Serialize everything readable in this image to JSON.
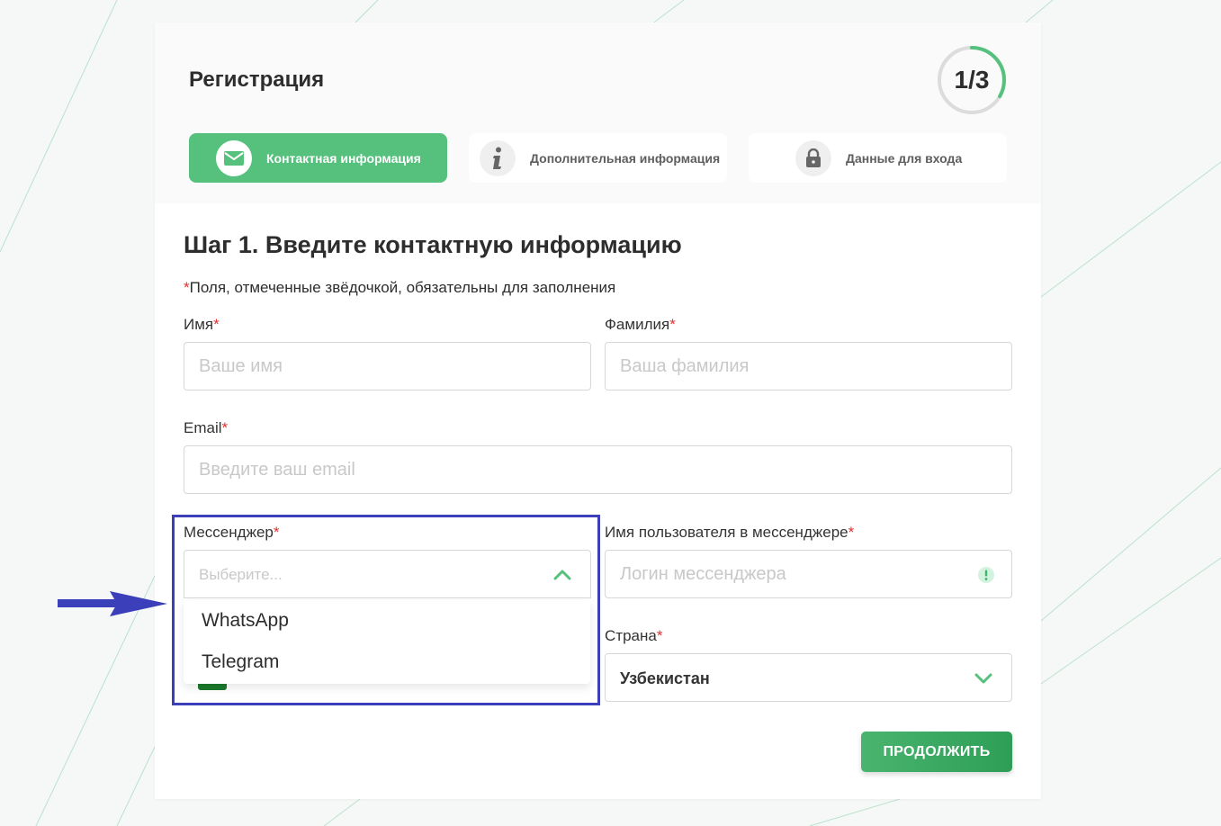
{
  "header": {
    "title": "Регистрация",
    "progress_text": "1/3",
    "progress_fraction": 0.333
  },
  "steps": [
    {
      "label": "Контактная информация",
      "icon": "mail-icon",
      "active": true
    },
    {
      "label": "Дополнительная информация",
      "icon": "info-icon",
      "active": false
    },
    {
      "label": "Данные для входа",
      "icon": "lock-icon",
      "active": false
    }
  ],
  "form": {
    "heading": "Шаг 1. Введите контактную информацию",
    "required_note_star": "*",
    "required_note": "Поля, отмеченные звёдочкой, обязательны для заполнения",
    "first_name": {
      "label": "Имя",
      "placeholder": "Ваше имя",
      "value": ""
    },
    "last_name": {
      "label": "Фамилия",
      "placeholder": "Ваша фамилия",
      "value": ""
    },
    "email": {
      "label": "Email",
      "placeholder": "Введите ваш email",
      "value": ""
    },
    "messenger": {
      "label": "Мессенджер",
      "placeholder": "Выберите...",
      "options": [
        "WhatsApp",
        "Telegram"
      ],
      "expanded": true
    },
    "messenger_username": {
      "label": "Имя пользователя в мессенджере",
      "placeholder": "Логин мессенджера",
      "value": ""
    },
    "country": {
      "label": "Страна",
      "value": "Узбекистан"
    },
    "required_star": "*",
    "continue_label": "ПРОДОЛЖИТЬ"
  },
  "colors": {
    "accent": "#55c17d",
    "required": "#e0302f",
    "annotation": "#3b3fba"
  }
}
